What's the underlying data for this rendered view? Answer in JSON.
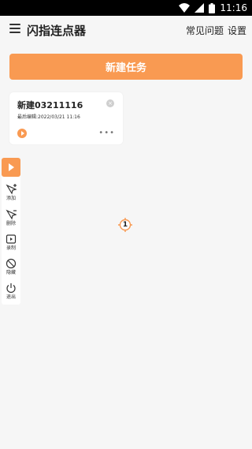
{
  "status_bar": {
    "time": "11:16"
  },
  "app_bar": {
    "title": "闪指连点器",
    "faq_label": "常见问题",
    "settings_label": "设置"
  },
  "new_task_label": "新建任务",
  "tasks": [
    {
      "name": "新建03211116",
      "meta": "最后编辑:2022/03/21 11:16"
    }
  ],
  "float_bar": {
    "items": [
      {
        "label": "添加",
        "icon": "add-pointer-icon"
      },
      {
        "label": "删除",
        "icon": "remove-pointer-icon"
      },
      {
        "label": "录制",
        "icon": "record-icon"
      },
      {
        "label": "隐藏",
        "icon": "hide-icon"
      },
      {
        "label": "退出",
        "icon": "power-icon"
      }
    ]
  },
  "click_target": {
    "number": "1"
  },
  "colors": {
    "accent": "#f99a52",
    "background": "#f6f6f6",
    "status_bar": "#000000"
  }
}
